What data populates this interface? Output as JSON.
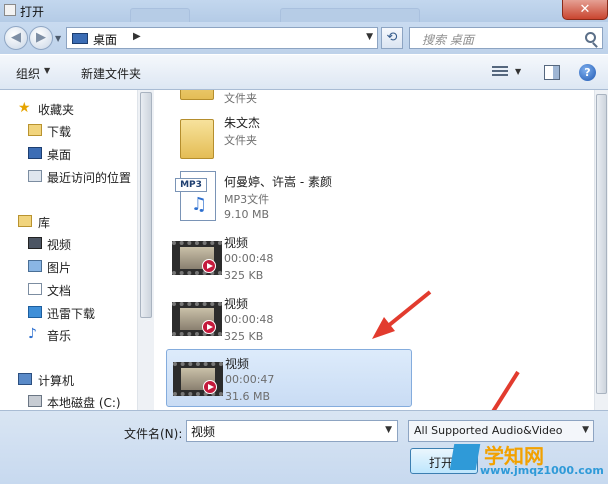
{
  "window": {
    "title": "打开"
  },
  "address": {
    "location": "桌面",
    "search_placeholder": "搜索 桌面"
  },
  "toolbar": {
    "organize_label": "组织",
    "new_folder_label": "新建文件夹"
  },
  "sidebar": {
    "favorites_label": "收藏夹",
    "favorites": [
      {
        "label": "下载",
        "icon": "download-folder-icon"
      },
      {
        "label": "桌面",
        "icon": "desktop-icon"
      },
      {
        "label": "最近访问的位置",
        "icon": "recent-places-icon"
      }
    ],
    "libraries_label": "库",
    "libraries": [
      {
        "label": "视频",
        "icon": "video-library-icon"
      },
      {
        "label": "图片",
        "icon": "pictures-library-icon"
      },
      {
        "label": "文档",
        "icon": "documents-library-icon"
      },
      {
        "label": "迅雷下载",
        "icon": "xunlei-download-icon"
      },
      {
        "label": "音乐",
        "icon": "music-library-icon"
      }
    ],
    "computer_label": "计算机",
    "drives": [
      {
        "label": "本地磁盘 (C:)",
        "icon": "local-disk-icon"
      }
    ]
  },
  "files": [
    {
      "name": "",
      "meta1": "文件夹",
      "meta2": "",
      "icon": "folder-icon"
    },
    {
      "name": "朱文杰",
      "meta1": "文件夹",
      "meta2": "",
      "icon": "folder-icon"
    },
    {
      "name": "何曼婷、许嵩 - 素颜",
      "meta1": "MP3文件",
      "meta2": "9.10 MB",
      "icon": "mp3-file-icon"
    },
    {
      "name": "视频",
      "meta1": "00:00:48",
      "meta2": "325 KB",
      "icon": "video-file-icon"
    },
    {
      "name": "视频",
      "meta1": "00:00:48",
      "meta2": "325 KB",
      "icon": "video-file-icon"
    },
    {
      "name": "视频",
      "meta1": "00:00:47",
      "meta2": "31.6 MB",
      "icon": "video-file-icon",
      "selected": true
    }
  ],
  "footer": {
    "filename_label": "文件名(N):",
    "filename_value": "视频",
    "filetype_value": "All Supported Audio&Video",
    "open_label": "打开(O)"
  },
  "watermark": {
    "line1": "学知网",
    "line2": "www.jmqz1000.com"
  },
  "colors": {
    "selection": "#cce0f7",
    "annotation_arrow": "#e23b2e"
  }
}
